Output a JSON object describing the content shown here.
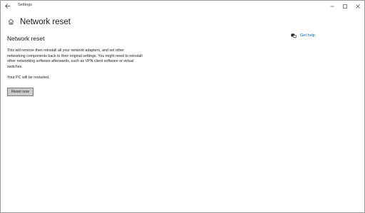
{
  "window": {
    "title": "Settings",
    "controls": {
      "minimize": "minimize-icon",
      "maximize": "maximize-icon",
      "close": "close-icon"
    }
  },
  "header": {
    "home_icon": "home-icon",
    "title": "Network reset"
  },
  "main": {
    "section_title": "Network reset",
    "description": "This will remove then reinstall all your network adapters, and set other networking components back to their original settings. You might need to reinstall other networking software afterwards, such as VPN client software or virtual switches.",
    "restart_note": "Your PC will be restarted.",
    "reset_button_label": "Reset now"
  },
  "help": {
    "icon": "chat-help-icon",
    "label": "Get help"
  },
  "colors": {
    "accent": "#0063b1",
    "button_bg": "#cccccc",
    "button_border": "#7a7a7a",
    "text": "#1a1a1a"
  }
}
